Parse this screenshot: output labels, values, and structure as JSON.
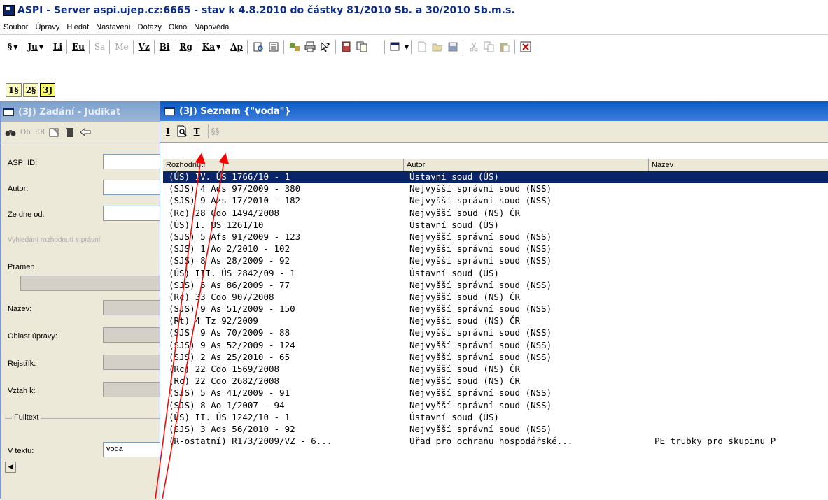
{
  "window": {
    "title": "ASPI - Server aspi.ujep.cz:6665 - stav k 4.8.2010 do částky 81/2010 Sb. a 30/2010 Sb.m.s."
  },
  "menu": [
    "Soubor",
    "Úpravy",
    "Hledat",
    "Nastavení",
    "Dotazy",
    "Okno",
    "Nápověda"
  ],
  "toolbar": {
    "items": [
      "§",
      "Ju",
      "Li",
      "Eu",
      "Sa",
      "Me",
      "Vz",
      "Bi",
      "Rg",
      "Ka",
      "Ap"
    ]
  },
  "doc_tabs": [
    "1§",
    "2§",
    "3J"
  ],
  "left_window": {
    "title": "(3J)  Zadání - Judikat",
    "toolbar_labels": [
      "Ob",
      "ER"
    ],
    "fields": {
      "aspi_id": "ASPI ID:",
      "autor": "Autor:",
      "ze_dne": "Ze dne od:",
      "hint": "Vyhledání rozhodnutí s právní",
      "pramen": "Pramen",
      "nazev": "Název:",
      "oblast": "Oblast úpravy:",
      "rejstrik": "Rejstřík:",
      "vztah": "Vztah k:",
      "fulltext": "Fulltext",
      "v_textu": "V textu:",
      "v_textu_value": "voda"
    }
  },
  "right_window": {
    "title": "(3J)  Seznam {\"voda\"}",
    "toolbar": {
      "i": "I",
      "t": "T",
      "ss": "§§"
    },
    "columns": [
      "Rozhodnutí",
      "Autor",
      "Název"
    ],
    "rows": [
      {
        "r": "(ÚS) IV. ÚS 1766/10 - 1",
        "a": "Ústavní soud (ÚS)",
        "n": ""
      },
      {
        "r": "(SJS) 4 Ads 97/2009 - 380",
        "a": "Nejvyšší správní soud (NSS)",
        "n": ""
      },
      {
        "r": "(SJS) 9 Azs 17/2010 - 182",
        "a": "Nejvyšší správní soud (NSS)",
        "n": ""
      },
      {
        "r": "(Rc) 28 Cdo 1494/2008",
        "a": "Nejvyšší soud (NS) ČR",
        "n": ""
      },
      {
        "r": "(ÚS) I. ÚS 1261/10",
        "a": "Ústavní soud (ÚS)",
        "n": ""
      },
      {
        "r": "(SJS) 5 Afs 91/2009 - 123",
        "a": "Nejvyšší správní soud (NSS)",
        "n": ""
      },
      {
        "r": "(SJS) 1 Ao 2/2010 - 102",
        "a": "Nejvyšší správní soud (NSS)",
        "n": ""
      },
      {
        "r": "(SJS) 8 As 28/2009 - 92",
        "a": "Nejvyšší správní soud (NSS)",
        "n": ""
      },
      {
        "r": "(ÚS) III. ÚS 2842/09 - 1",
        "a": "Ústavní soud (ÚS)",
        "n": ""
      },
      {
        "r": "(SJS) 5 As 86/2009 - 77",
        "a": "Nejvyšší správní soud (NSS)",
        "n": ""
      },
      {
        "r": "(Rc) 33 Cdo 907/2008",
        "a": "Nejvyšší soud (NS) ČR",
        "n": ""
      },
      {
        "r": "(SJS) 9 As 51/2009 - 150",
        "a": "Nejvyšší správní soud (NSS)",
        "n": ""
      },
      {
        "r": "(Rt) 4 Tz 92/2009",
        "a": "Nejvyšší soud (NS) ČR",
        "n": ""
      },
      {
        "r": "(SJS) 9 As 70/2009 - 88",
        "a": "Nejvyšší správní soud (NSS)",
        "n": ""
      },
      {
        "r": "(SJS) 9 As 52/2009 - 124",
        "a": "Nejvyšší správní soud (NSS)",
        "n": ""
      },
      {
        "r": "(SJS) 2 As 25/2010 - 65",
        "a": "Nejvyšší správní soud (NSS)",
        "n": ""
      },
      {
        "r": "(Rc) 22 Cdo 1569/2008",
        "a": "Nejvyšší soud (NS) ČR",
        "n": ""
      },
      {
        "r": "(Rc) 22 Cdo 2682/2008",
        "a": "Nejvyšší soud (NS) ČR",
        "n": ""
      },
      {
        "r": "(SJS) 5 As 41/2009 - 91",
        "a": "Nejvyšší správní soud (NSS)",
        "n": ""
      },
      {
        "r": "(SJS) 8 Ao 1/2007 - 94",
        "a": "Nejvyšší správní soud (NSS)",
        "n": ""
      },
      {
        "r": "(ÚS) II. ÚS 1242/10 - 1",
        "a": "Ústavní soud (ÚS)",
        "n": ""
      },
      {
        "r": "(SJS) 3 Ads 56/2010 - 92",
        "a": "Nejvyšší správní soud (NSS)",
        "n": ""
      },
      {
        "r": "(R-ostatní) R173/2009/VZ - 6...",
        "a": "Úřad pro ochranu hospodářské...",
        "n": "PE trubky pro skupinu P"
      }
    ]
  },
  "colors": {
    "selection": "#0a246a",
    "active_title": "#0a5bc4",
    "arrow": "#ff0000"
  }
}
